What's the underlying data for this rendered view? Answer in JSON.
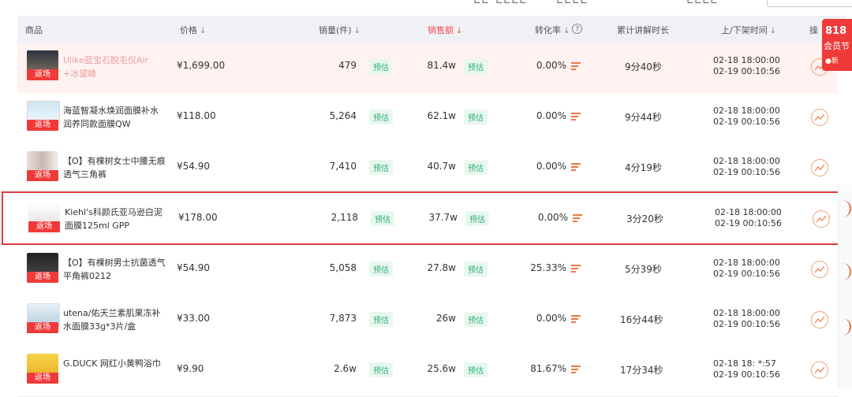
{
  "topbar": {
    "fragments": [
      "∟∟",
      "∟∟∟∟",
      "∟∟∟∟",
      "∟∟∟∟"
    ]
  },
  "columns": {
    "product": "商品",
    "price": "价格",
    "sales": "销量(件)",
    "revenue": "销售额",
    "conversion": "转化率",
    "duration": "累计讲解时长",
    "shelf_time": "上/下架时间",
    "op": "操",
    "sort_mark": "↓",
    "help_icon": "?"
  },
  "badge_label": "预估",
  "tag_label": "返场",
  "colors": {
    "accent_red": "#f03a3a",
    "estimate_green": "#31b27a",
    "header_bg": "#eff1f5"
  },
  "rows": [
    {
      "name": "Ulike蓝宝石脱毛仪Air +冰望峰",
      "price": "¥1,699.00",
      "sales": "479",
      "revenue": "81.4w",
      "conversion": "0.00%",
      "duration": "9分40秒",
      "on_time": "02-18   18:00:00",
      "off_time": "02-19   00:10:56"
    },
    {
      "name": "海蓝智凝水焕润面膜补水润养同款面膜QW",
      "price": "¥118.00",
      "sales": "5,264",
      "revenue": "62.1w",
      "conversion": "0.00%",
      "duration": "9分44秒",
      "on_time": "02-18   18:00:00",
      "off_time": "02-19   00:10:56"
    },
    {
      "name": "【O】有棵树女士中腰无痕透气三角裤",
      "price": "¥54.90",
      "sales": "7,410",
      "revenue": "40.7w",
      "conversion": "0.00%",
      "duration": "4分19秒",
      "on_time": "02-18   18:00:00",
      "off_time": "02-19   00:10:56"
    },
    {
      "name": "Kiehl's科颜氏亚马逊白泥面膜125ml GPP",
      "price": "¥178.00",
      "sales": "2,118",
      "revenue": "37.7w",
      "conversion": "0.00%",
      "duration": "3分20秒",
      "on_time": "02-18   18:00:00",
      "off_time": "02-19   00:10:56"
    },
    {
      "name": "【O】有棵树男士抗菌透气平角裤0212",
      "price": "¥54.90",
      "sales": "5,058",
      "revenue": "27.8w",
      "conversion": "25.33%",
      "duration": "5分39秒",
      "on_time": "02-18   18:00:00",
      "off_time": "02-19   00:10:56"
    },
    {
      "name": "utena/佑天兰素肌果冻补水面膜33g*3片/盒",
      "price": "¥33.00",
      "sales": "7,873",
      "revenue": "26w",
      "conversion": "0.00%",
      "duration": "16分44秒",
      "on_time": "02-18   18:00:00",
      "off_time": "02-19   00:10:56"
    },
    {
      "name": "G.DUCK 网红小黄鸭浴巾",
      "price": "¥9.90",
      "sales": "2.6w",
      "revenue": "25.6w",
      "conversion": "81.67%",
      "duration": "17分34秒",
      "on_time": "02-18   18:  *:57",
      "off_time": "02-19   00:10:56"
    }
  ],
  "side_float": {
    "line1": "818",
    "line2": "会员节",
    "line3": "●新"
  }
}
